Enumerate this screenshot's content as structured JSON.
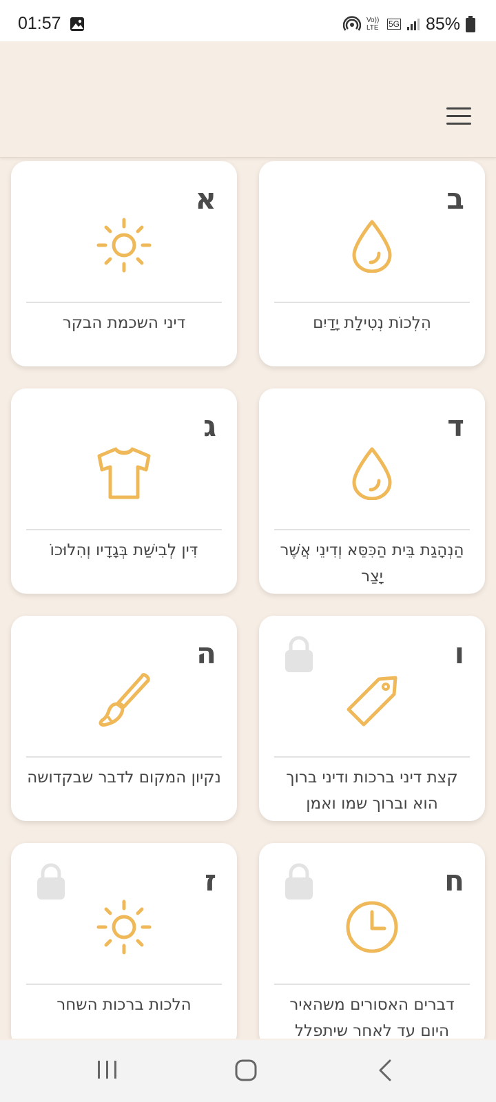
{
  "status_bar": {
    "time": "01:57",
    "battery": "85%",
    "network": "5G",
    "volte": "Vo)) LTE"
  },
  "header": {
    "menu_icon": "hamburger-menu-icon"
  },
  "cards": [
    {
      "letter": "ב",
      "title": "הִלְכוֹת נְטִילַת יָדַיִם",
      "icon": "drop-icon",
      "locked": false
    },
    {
      "letter": "א",
      "title": "דיני השכמת הבקר",
      "icon": "sun-icon",
      "locked": false
    },
    {
      "letter": "ד",
      "title": "הַנְהָגַת בֵּית הַכִּסֵּא וְדִינֵי אֲשֶׁר יָצַר",
      "icon": "drop-icon",
      "locked": false
    },
    {
      "letter": "ג",
      "title": "דִּין לְבִישַׁת בְּגָדָיו וְהִלוּכוֹ",
      "icon": "shirt-icon",
      "locked": false
    },
    {
      "letter": "ו",
      "title": "קצת דיני ברכות ודיני ברוך הוא וברוך שמו ואמן",
      "icon": "tag-icon",
      "locked": true
    },
    {
      "letter": "ה",
      "title": "נקיון המקום לדבר שבקדושה",
      "icon": "brush-icon",
      "locked": false
    },
    {
      "letter": "ח",
      "title": "דברים האסורים משהאיר היום עד לאחר שיתפלל",
      "icon": "clock-icon",
      "locked": true
    },
    {
      "letter": "ז",
      "title": "הלכות ברכות השחר",
      "icon": "sun-icon",
      "locked": true
    }
  ],
  "colors": {
    "background": "#f6ede4",
    "accent": "#efb95a",
    "lock": "#e3e3e3"
  },
  "nav_bar": {
    "recents_icon": "recents-icon",
    "home_icon": "home-icon",
    "back_icon": "back-icon"
  }
}
